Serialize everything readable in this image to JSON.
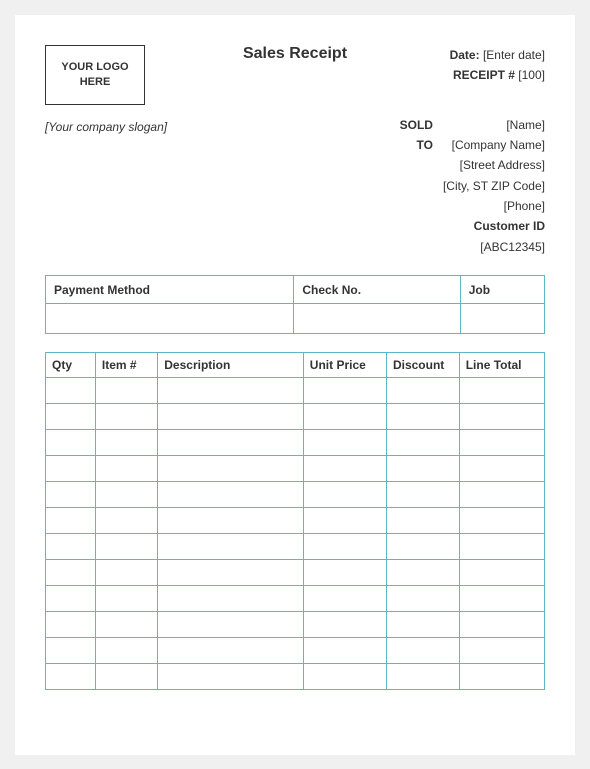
{
  "title": "Sales Receipt",
  "logo": {
    "text": "YOUR LOGO HERE"
  },
  "header": {
    "date_label": "Date:",
    "date_value": "[Enter date]",
    "receipt_label": "RECEIPT #",
    "receipt_value": "[100]"
  },
  "sold_to": {
    "label_line1": "SOLD",
    "label_line2": "TO",
    "name": "[Name]",
    "company": "[Company Name]",
    "street": "[Street Address]",
    "city": "[City, ST  ZIP Code]",
    "phone": "[Phone]",
    "customer_id_label": "Customer ID",
    "customer_id_value": "[ABC12345]"
  },
  "slogan": "[Your company slogan]",
  "payment_table": {
    "columns": [
      "Payment Method",
      "Check No.",
      "Job"
    ],
    "rows": [
      [
        "",
        "",
        ""
      ]
    ]
  },
  "items_table": {
    "columns": [
      "Qty",
      "Item #",
      "Description",
      "Unit Price",
      "Discount",
      "Line Total"
    ],
    "num_rows": 12
  }
}
